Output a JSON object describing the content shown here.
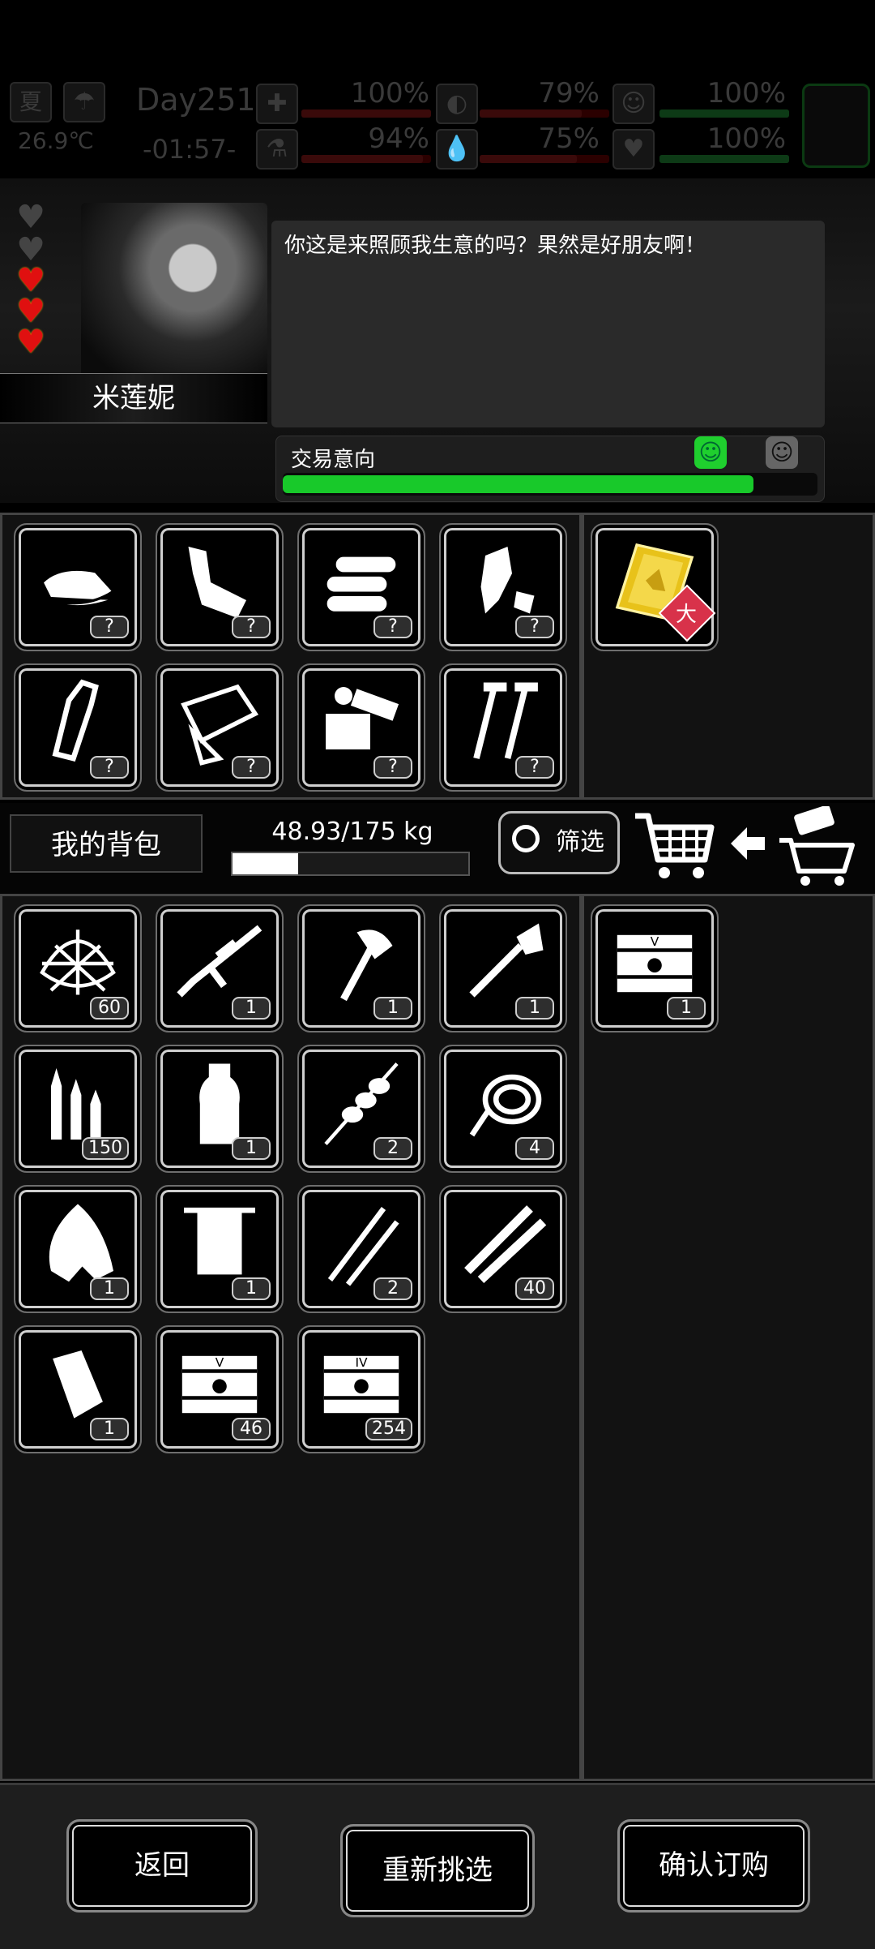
{
  "status": {
    "season": "夏",
    "temperature": "26.9℃",
    "day": "Day251",
    "time": "-01:57-",
    "health_pct": "100%",
    "hunger_pct": "79%",
    "mood_pct": "100%",
    "medicine_pct": "94%",
    "thirst_pct": "75%",
    "heart_pct": "100%",
    "health_level": 1.0,
    "hunger_level": 0.79,
    "mood_level": 1.0,
    "medicine_level": 0.94,
    "thirst_level": 0.75,
    "heart_level": 1.0
  },
  "npc": {
    "name": "米莲妮",
    "dialogue": "你这是来照顾我生意的吗？果然是好朋友啊！",
    "hearts_filled": 3,
    "hearts_total": 5
  },
  "trade": {
    "label": "交易意向",
    "level": 0.88,
    "face_happy": "smiley-green-icon",
    "face_neutral": "smiley-grey-icon"
  },
  "merchant": {
    "items": [
      {
        "icon": "cloth-icon",
        "qty": "?"
      },
      {
        "icon": "scrap-metal-icon",
        "qty": "?"
      },
      {
        "icon": "logs-icon",
        "qty": "?"
      },
      {
        "icon": "plastic-scrap-icon",
        "qty": "?"
      },
      {
        "icon": "bottle-icon",
        "qty": "?"
      },
      {
        "icon": "glass-shards-icon",
        "qty": "?"
      },
      {
        "icon": "machine-parts-icon",
        "qty": "?"
      },
      {
        "icon": "screws-icon",
        "qty": "?"
      }
    ],
    "special_item": {
      "icon": "gold-card-icon",
      "badge": "大"
    }
  },
  "bag": {
    "title": "我的背包",
    "weight": "48.93/175 kg",
    "weight_fraction": 0.28,
    "filter_label": "筛选",
    "items": [
      {
        "icon": "net-icon",
        "qty": "60"
      },
      {
        "icon": "sniper-rifle-icon",
        "qty": "1"
      },
      {
        "icon": "axe-icon",
        "qty": "1"
      },
      {
        "icon": "shovel-icon",
        "qty": "1"
      },
      {
        "icon": "bullets-icon",
        "qty": "150"
      },
      {
        "icon": "water-bottle-icon",
        "qty": "1"
      },
      {
        "icon": "skewer-icon",
        "qty": "2"
      },
      {
        "icon": "rope-icon",
        "qty": "4"
      },
      {
        "icon": "torn-cloth-icon",
        "qty": "1"
      },
      {
        "icon": "towel-icon",
        "qty": "1"
      },
      {
        "icon": "lockpick-icon",
        "qty": "2"
      },
      {
        "icon": "darts-icon",
        "qty": "40"
      },
      {
        "icon": "bandage-icon",
        "qty": "1"
      },
      {
        "icon": "crate-v-icon",
        "qty": "46"
      },
      {
        "icon": "crate-iv-icon",
        "qty": "254"
      }
    ],
    "order_items": [
      {
        "icon": "crate-v-icon",
        "qty": "1"
      }
    ]
  },
  "buttons": {
    "back": "返回",
    "reselect": "重新挑选",
    "confirm": "确认订购"
  }
}
